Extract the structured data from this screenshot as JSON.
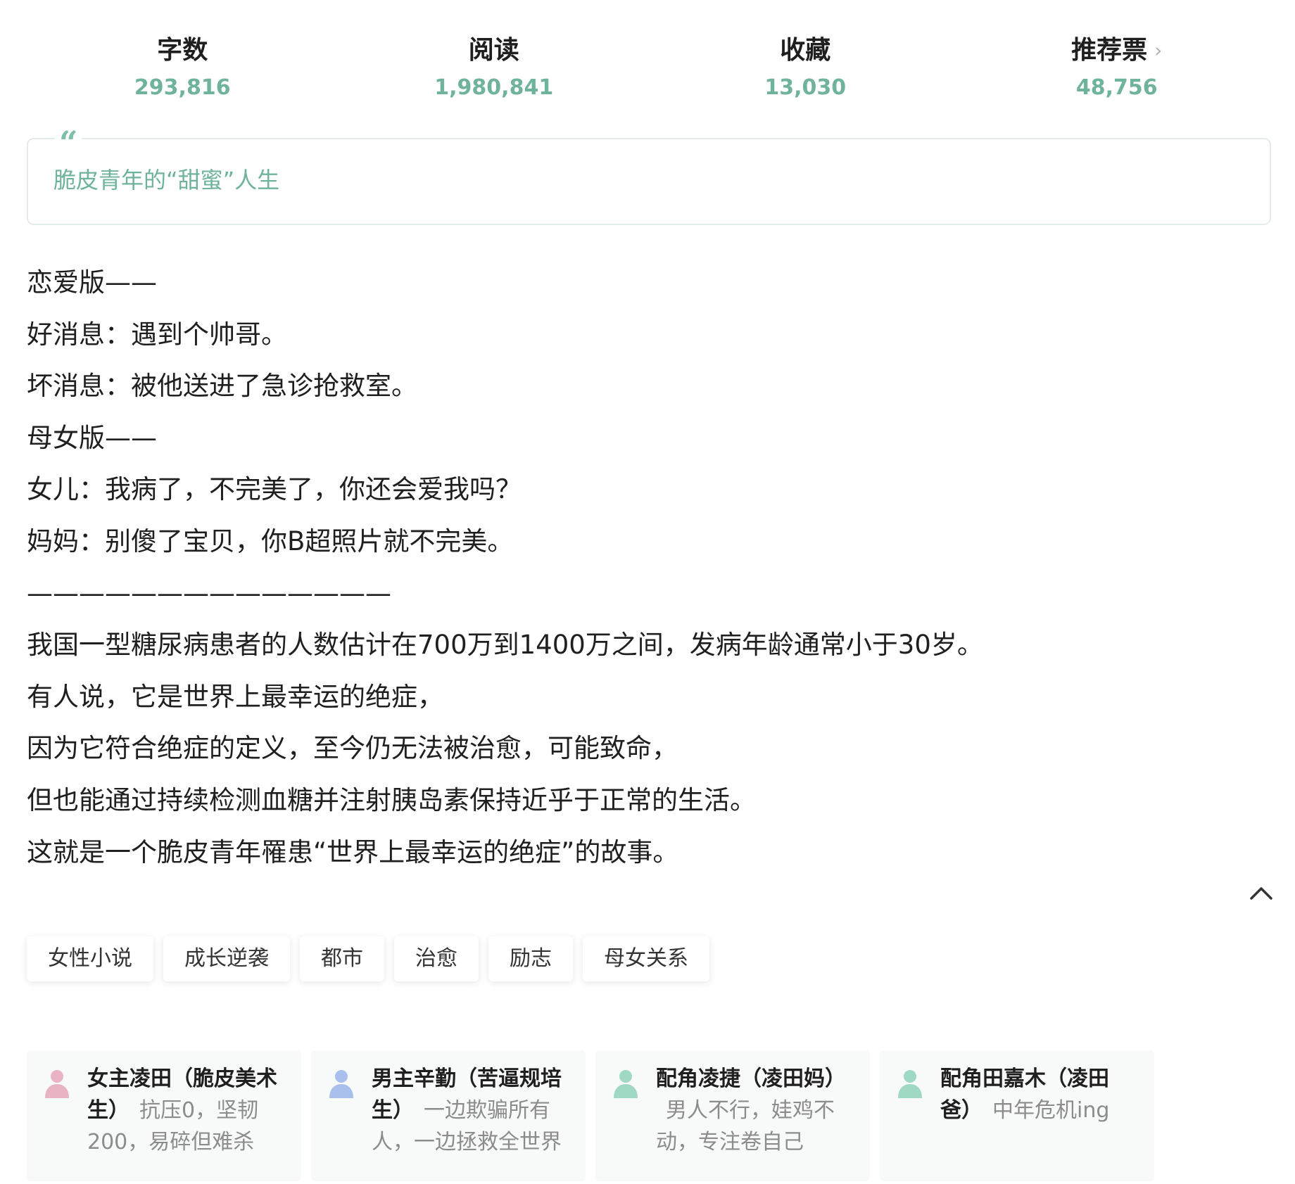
{
  "stats": [
    {
      "label": "字数",
      "value": "293,816"
    },
    {
      "label": "阅读",
      "value": "1,980,841"
    },
    {
      "label": "收藏",
      "value": "13,030"
    },
    {
      "label": "推荐票",
      "value": "48,756"
    }
  ],
  "quote": {
    "mark": "“",
    "text": "脆皮青年的“甜蜜”人生"
  },
  "synopsis": [
    "恋爱版——",
    "好消息：遇到个帅哥。",
    "坏消息：被他送进了急诊抢救室。",
    "母女版——",
    "女儿：我病了，不完美了，你还会爱我吗？",
    "妈妈：别傻了宝贝，你B超照片就不完美。",
    "——————————————",
    "我国一型糖尿病患者的人数估计在700万到1400万之间，发病年龄通常小于30岁。",
    "有人说，它是世界上最幸运的绝症，",
    "因为它符合绝症的定义，至今仍无法被治愈，可能致命，",
    "但也能通过持续检测血糖并注射胰岛素保持近乎于正常的生活。",
    "这就是一个脆皮青年罹患“世界上最幸运的绝症”的故事。"
  ],
  "tags": [
    "女性小说",
    "成长逆袭",
    "都市",
    "治愈",
    "励志",
    "母女关系"
  ],
  "roles": [
    {
      "name": "女主凌田（脆皮美术生）",
      "desc": "抗压0，坚韧200，易碎但难杀",
      "icon": "person-icon",
      "color": "#e8b4c3"
    },
    {
      "name": "男主辛勤（苦逼规培生）",
      "desc": "一边欺骗所有人，一边拯救全世界",
      "icon": "person-icon",
      "color": "#a9c0ec"
    },
    {
      "name": "配角凌捷（凌田妈）",
      "desc": "男人不行，娃鸡不动，专注卷自己",
      "icon": "person-icon",
      "color": "#9fd9c3"
    },
    {
      "name": "配角田嘉木（凌田爸）",
      "desc": "中年危机ing",
      "icon": "person-icon",
      "color": "#9fd9c3"
    }
  ],
  "colors": {
    "accent": "#6fb39c",
    "text": "#1f1f1f",
    "muted": "#8c8c8c",
    "border": "#e3ece8"
  }
}
